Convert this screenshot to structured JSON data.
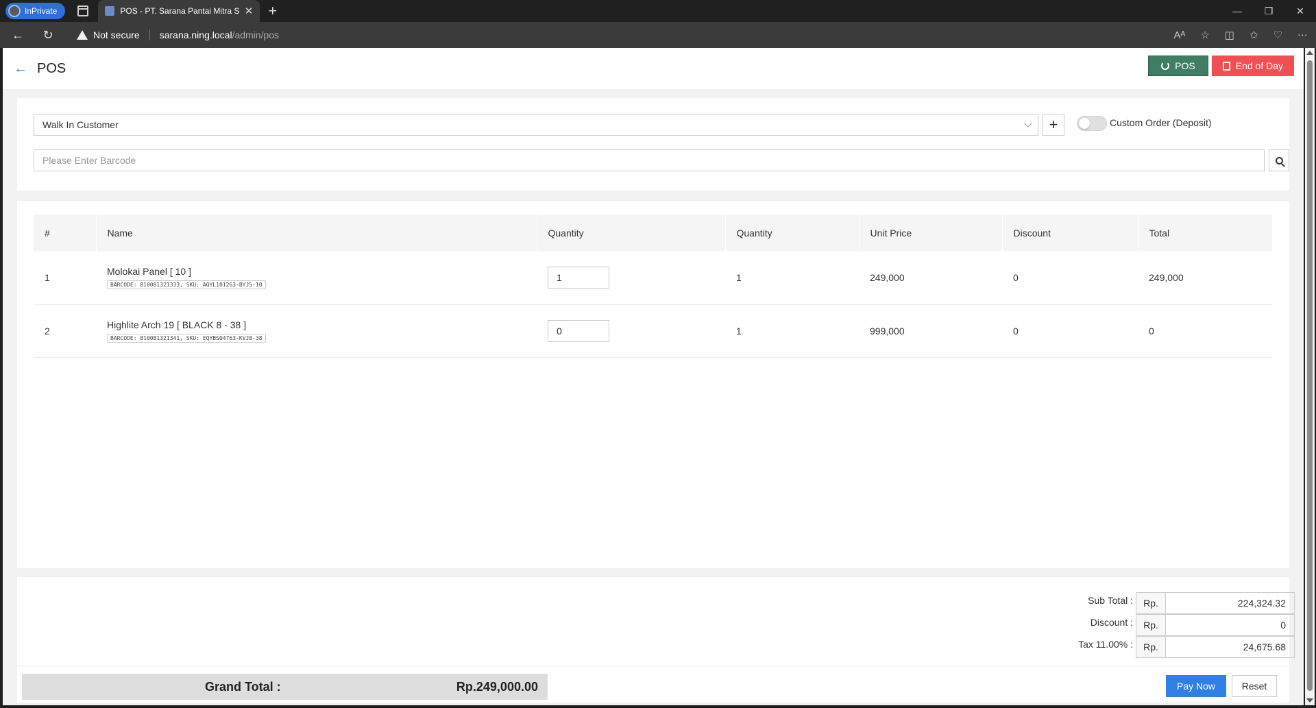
{
  "browser": {
    "inprivate_label": "InPrivate",
    "tab_title": "POS - PT. Sarana Pantai Mitra Se",
    "security_label": "Not secure",
    "url_host": "sarana.ning.local",
    "url_path": "/admin/pos"
  },
  "header": {
    "title": "POS",
    "pos_button": "POS",
    "eod_button": "End of Day"
  },
  "customer": {
    "selected": "Walk In Customer",
    "add_label": "+",
    "custom_order_label": "Custom Order (Deposit)",
    "custom_order_on": false
  },
  "barcode": {
    "placeholder": "Please Enter Barcode"
  },
  "table": {
    "headers": [
      "#",
      "Name",
      "Quantity",
      "Quantity",
      "Unit Price",
      "Discount",
      "Total"
    ],
    "rows": [
      {
        "no": "1",
        "name": "Molokai Panel [ 10 ]",
        "meta": "BARCODE: 810081321333, SKU: AQYL101263-BYJ5-10",
        "qty_input": "1",
        "qty": "1",
        "unit_price": "249,000",
        "discount": "0",
        "total": "249,000"
      },
      {
        "no": "2",
        "name": "Highlite Arch 19 [ BLACK 8 - 38 ]",
        "meta": "BARCODE: 810081321341, SKU: EQYBS04763-KVJ8-38",
        "qty_input": "0",
        "qty": "1",
        "unit_price": "999,000",
        "discount": "0",
        "total": "0"
      }
    ]
  },
  "summary": {
    "currency": "Rp.",
    "subtotal_label": "Sub Total :",
    "subtotal": "224,324.32",
    "discount_label": "Discount :",
    "discount": "0",
    "tax_label": "Tax 11.00% :",
    "tax": "24,675.68",
    "grand_total_label": "Grand Total :",
    "grand_total": "Rp.249,000.00"
  },
  "actions": {
    "pay_now": "Pay Now",
    "reset": "Reset"
  },
  "colors": {
    "pos_button": "#3f7d64",
    "eod_button": "#f04f54",
    "pay_button": "#2f7fe6"
  }
}
